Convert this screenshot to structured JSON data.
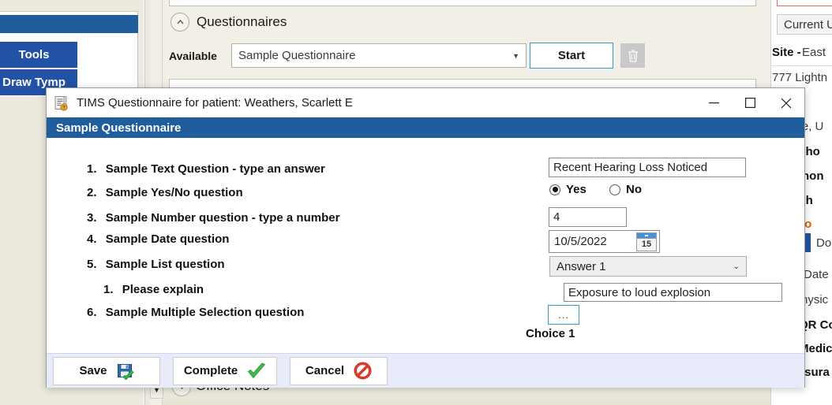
{
  "background": {
    "left_buttons": [
      {
        "label": "Tools",
        "name": "tools-button"
      },
      {
        "label": "Draw Tymp",
        "name": "draw-tymp-button"
      }
    ],
    "section": {
      "title": "Questionnaires",
      "collapse_icon": "chevron-up-icon"
    },
    "available": {
      "label": "Available",
      "value": "Sample Questionnaire",
      "dropdown_icon": "chevron-down-icon"
    },
    "start_button": "Start",
    "delete_icon": "trash-icon",
    "office_notes": {
      "title": "Office Notes",
      "collapse_icon": "chevron-down-icon"
    },
    "right_panel": {
      "current_user_button": "Current U",
      "site_label": "Site -",
      "site_value": "East",
      "address": "777 Lightn",
      "city": "ake, U",
      "rows": [
        "e Pho",
        "Phon",
        "le Ph",
        "Pho",
        "Do",
        "Date",
        "hysic",
        "QR Co",
        "Medic",
        "nsura"
      ],
      "accent_orange": "#e8590c",
      "accent_blue": "#2252a6"
    }
  },
  "dialog": {
    "icon": "questionnaire-document-icon",
    "title": "TIMS Questionnaire for patient: Weathers, Scarlett E",
    "window_controls": {
      "minimize": "minimize-icon",
      "maximize": "maximize-icon",
      "close": "close-icon"
    },
    "header": "Sample Questionnaire",
    "header_color": "#1f5d9c",
    "footer_color": "#e8ecfa",
    "questions": [
      {
        "num": "1.",
        "text": "Sample Text Question - type an answer"
      },
      {
        "num": "2.",
        "text": "Sample Yes/No question"
      },
      {
        "num": "3.",
        "text": "Sample Number question - type a number"
      },
      {
        "num": "4.",
        "text": "Sample Date question"
      },
      {
        "num": "5.",
        "text": "Sample List question"
      },
      {
        "num": "1.",
        "text": "Please explain"
      },
      {
        "num": "6.",
        "text": "Sample Multiple Selection question"
      }
    ],
    "answers": {
      "text_answer": "Recent Hearing Loss Noticed",
      "yesno": {
        "yes_label": "Yes",
        "no_label": "No",
        "selected": "Yes"
      },
      "number_answer": "4",
      "date_answer": "10/5/2022",
      "calendar_day": "15",
      "list_answer": "Answer 1",
      "list_dropdown_icon": "chevron-down-icon",
      "explain_answer": "Exposure to loud explosion",
      "multi_button": "...",
      "choice_label": "Choice 1"
    },
    "footer_buttons": [
      {
        "label": "Save",
        "icon": "save-floppy-icon",
        "name": "save-button"
      },
      {
        "label": "Complete",
        "icon": "checkmark-icon",
        "name": "complete-button"
      },
      {
        "label": "Cancel",
        "icon": "prohibition-icon",
        "name": "cancel-button"
      }
    ]
  }
}
